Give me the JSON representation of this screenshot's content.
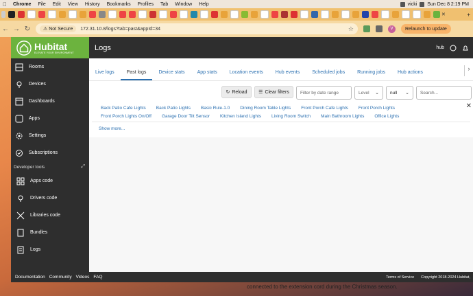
{
  "menubar": {
    "app": "Chrome",
    "items": [
      "File",
      "Edit",
      "View",
      "History",
      "Bookmarks",
      "Profiles",
      "Tab",
      "Window",
      "Help"
    ],
    "user": "vicki",
    "datetime": "Sun Dec 8  2:19 PM"
  },
  "toolbar": {
    "not_secure": "Not Secure",
    "url": "172.31.10.8/logs?tab=past&appId=34",
    "profile_initial": "V",
    "relaunch": "Relaunch to update"
  },
  "header": {
    "brand": "Hubitat",
    "tagline": "ELEVATE YOUR ENVIRONMENT",
    "page_title": "Logs",
    "hub": "hub"
  },
  "sidebar": {
    "items": [
      {
        "label": "Rooms",
        "icon": "rooms-icon"
      },
      {
        "label": "Devices",
        "icon": "devices-icon"
      },
      {
        "label": "Dashboards",
        "icon": "dashboards-icon"
      },
      {
        "label": "Apps",
        "icon": "apps-icon"
      },
      {
        "label": "Settings",
        "icon": "settings-icon"
      },
      {
        "label": "Subscriptions",
        "icon": "subscriptions-icon"
      }
    ],
    "section": "Developer tools",
    "dev_items": [
      {
        "label": "Apps code",
        "icon": "apps-code-icon"
      },
      {
        "label": "Drivers code",
        "icon": "drivers-code-icon"
      },
      {
        "label": "Libraries code",
        "icon": "libraries-code-icon"
      },
      {
        "label": "Bundles",
        "icon": "bundles-icon"
      },
      {
        "label": "Logs",
        "icon": "logs-icon"
      }
    ]
  },
  "tabs": [
    "Live logs",
    "Past logs",
    "Device stats",
    "App stats",
    "Location events",
    "Hub events",
    "Scheduled jobs",
    "Running jobs",
    "Hub actions"
  ],
  "active_tab": "Past logs",
  "filters": {
    "reload": "Reload",
    "clear": "Clear filters",
    "date_placeholder": "Filter by date range",
    "level": "Level",
    "null_select": "null",
    "search_placeholder": "Search..."
  },
  "devices_row1": [
    "Back Patio Cafe Lights",
    "Back Patio Lights",
    "Basic Rule-1.0",
    "Dining Room Table Lights",
    "Front Porch Cafe Lights",
    "Front Porch Lights"
  ],
  "devices_row2": [
    "Front Porch Lights On/Off",
    "Garage Door Tilt Sensor",
    "Kitchen Island Lights",
    "Living Room Switch",
    "Main Bathroom Lights",
    "Office Lights"
  ],
  "show_more": "Show more...",
  "footer": {
    "links": [
      "Documentation",
      "Community",
      "Videos",
      "FAQ"
    ],
    "terms": "Terms of Service",
    "copyright": "Copyright 2018-2024 Hubitat,"
  },
  "background_text": "connected to the extension cord during the Christmas season.",
  "colors": {
    "brand_green": "#6cb33e",
    "dark": "#2e2e2e",
    "link_blue": "#2a6fb0"
  }
}
